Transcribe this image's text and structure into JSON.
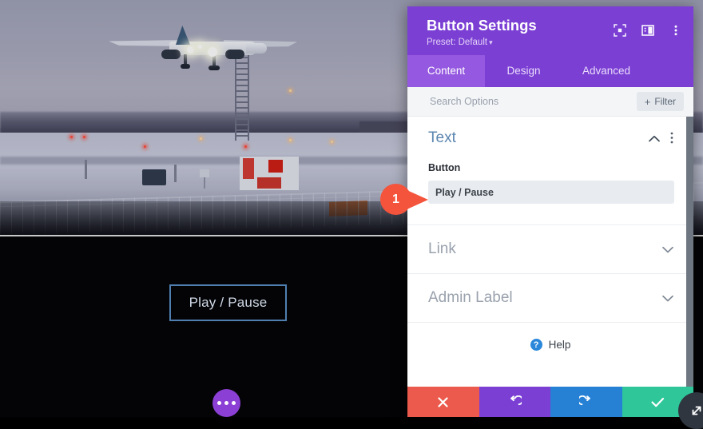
{
  "canvas": {
    "video_scene": "airplane-landing-snowy-airport-dusk",
    "play_pause_button": "Play / Pause",
    "settings_dots": "options-menu"
  },
  "modal": {
    "title": "Button Settings",
    "preset_label": "Preset: Default",
    "preset_caret": "▾",
    "header_icons": [
      {
        "name": "focus-mode-icon",
        "glyph": "focus"
      },
      {
        "name": "layout-view-icon",
        "glyph": "layout"
      },
      {
        "name": "more-options-icon",
        "glyph": "kebab"
      }
    ],
    "tabs": [
      {
        "label": "Content",
        "active": true
      },
      {
        "label": "Design",
        "active": false
      },
      {
        "label": "Advanced",
        "active": false
      }
    ],
    "search": {
      "placeholder": "Search Options",
      "value": ""
    },
    "filter_button": {
      "label": "Filter",
      "plus": "+"
    },
    "sections": [
      {
        "title": "Text",
        "state": "expanded",
        "chevron": "⌃",
        "kebab": "⋮",
        "fields": [
          {
            "label": "Button",
            "value": "Play / Pause"
          }
        ]
      },
      {
        "title": "Link",
        "state": "collapsed",
        "chevron": "⌄"
      },
      {
        "title": "Admin Label",
        "state": "collapsed",
        "chevron": "⌄"
      }
    ],
    "help": {
      "icon_glyph": "?",
      "label": "Help"
    },
    "footer_buttons": [
      {
        "name": "cancel",
        "glyph": "✕",
        "color": "#eb5a4c"
      },
      {
        "name": "undo",
        "glyph": "↺",
        "color": "#7b3fd4"
      },
      {
        "name": "redo",
        "glyph": "↻",
        "color": "#2681d4"
      },
      {
        "name": "save",
        "glyph": "✓",
        "color": "#2fc79a"
      }
    ],
    "resize_handle": "resize-diagonal"
  },
  "marker": {
    "number": "1",
    "color": "#f4533c"
  },
  "colors": {
    "brand_purple": "#7b3fd4",
    "active_tab": "#9558e0",
    "section_title": "#5b86b0",
    "marker": "#f4533c"
  }
}
